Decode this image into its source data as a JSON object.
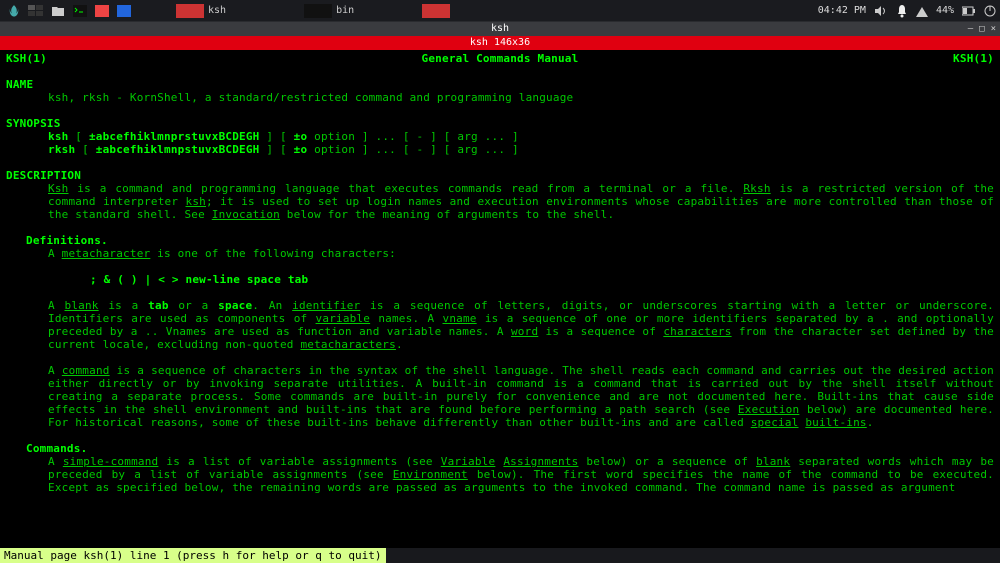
{
  "taskbar": {
    "items": [
      {
        "label": "ksh",
        "thumb": "red"
      },
      {
        "label": "bin",
        "thumb": "black"
      },
      {
        "label": "",
        "thumb": "red"
      }
    ],
    "time": "04:42 PM",
    "battery": "44%"
  },
  "window": {
    "title": "ksh",
    "termtitle": "ksh 146x36"
  },
  "man": {
    "header_left": "KSH(1)",
    "header_center": "General Commands Manual",
    "header_right": "KSH(1)",
    "name_hdr": "NAME",
    "name_line": "ksh, rksh - KornShell, a standard/restricted command and programming language",
    "synopsis_hdr": "SYNOPSIS",
    "syn1_cmd": "ksh",
    "syn1_flags": "±abcefhiklmnprstuvxBCDEGH",
    "syn1_mid": " ] [ ",
    "syn1_pm": "±o",
    "syn1_rest": " option ] ... [ - ] [ arg ... ]",
    "syn2_cmd": "rksh",
    "syn2_flags": "±abcefhiklmnpstuvxBCDEGH",
    "syn2_mid": " ] [ ",
    "syn2_pm": "±o",
    "syn2_rest": " option ] ... [ - ] [ arg ... ]",
    "desc_hdr": "DESCRIPTION",
    "desc_ksh": "Ksh",
    "desc_p1a": "  is  a command and programming language that executes commands read from a terminal or a file.  ",
    "desc_rksh": "Rksh",
    "desc_p1b": " is a restricted version of the command interpreter ",
    "desc_kshu": "ksh",
    "desc_p1c": "; it is used to set up login names and execution environments whose capabilities are more controlled than  those of the standard shell.  See ",
    "desc_inv": "Invocation",
    "desc_p1d": " below for the meaning of arguments to the shell.",
    "defs_hdr": "Definitions.",
    "defs_a": "A ",
    "defs_meta": "metacharacter",
    "defs_a2": " is one of the following characters:",
    "metachars": ";   &   (   )   |   <   >   new-line   space   tab",
    "blank_a": "A  ",
    "blank_u": "blank",
    "blank_b": "  is  a  ",
    "blank_tab": "tab",
    "blank_c": "  or a  ",
    "blank_space": "space",
    "blank_d": ".  An  ",
    "blank_ident": "identifier",
    "blank_e": " is a sequence of letters, digits, or underscores starting with a letter or underscore.  Identifiers are used as components of ",
    "blank_var": "variable",
    "blank_f": " names.  A ",
    "blank_vname": "vname",
    "blank_g": " is a sequence of one or more identifiers separated by a . and optionally preceded by a ..  Vnames are used as function and variable names.  A ",
    "blank_word": "word",
    "blank_h": " is a sequence of ",
    "blank_chars": "characters",
    "blank_i": " from the character set defined by the current locale, excluding non-quoted ",
    "blank_meta2": "metacharacters",
    "blank_j": ".",
    "cmd_a": "A ",
    "cmd_u": "command",
    "cmd_b": " is a sequence of characters in the syntax of the shell language.  The shell reads each command and carries  out  the  desired action  either  directly  or  by  invoking separate utilities.  A built-in command is a command that is carried out by the shell itself without creating a separate process.  Some commands are built-in purely for convenience and are not documented  here.   Built-ins  that cause side effects in the shell environment and built-ins that are found before performing a path search (see ",
    "cmd_exec": "Execution",
    "cmd_c": " below) are documented here.  For historical reasons, some of these built-ins behave differently than other built-ins and are  called  ",
    "cmd_special": "special",
    "cmd_sp": "  ",
    "cmd_builtins": "built-ins",
    "cmd_d": ".",
    "commands_hdr": "Commands.",
    "sc_a": "A ",
    "sc_u": "simple-command",
    "sc_b": " is a list of variable assignments (see ",
    "sc_va": "Variable",
    "sc_sp1": " ",
    "sc_asgn": "Assignments",
    "sc_c": " below) or a sequence of ",
    "sc_blank": "blank",
    "sc_d": " separated words which may be preceded by a list of variable assignments (see ",
    "sc_env": "Environment",
    "sc_e": " below).  The first word specifies the name of the command to  be  executed.  Except  as specified below, the remaining words are passed as arguments to the invoked command.  The command name is passed as argument"
  },
  "status": " Manual page ksh(1) line 1 (press h for help or q to quit)"
}
